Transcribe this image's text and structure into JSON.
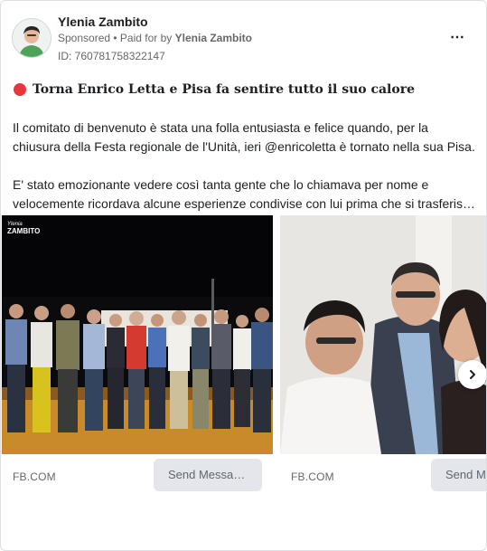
{
  "ad": {
    "advertiser_name": "Ylenia Zambito",
    "sponsored_label": "Sponsored",
    "paid_for_prefix": "• Paid for by",
    "paid_for_name": "Ylenia Zambito",
    "ad_id": "ID: 760781758322147",
    "more_icon": "⋯"
  },
  "post": {
    "headline": "Torna Enrico Letta e Pisa fa sentire tutto il suo calore",
    "paragraphs": [
      "Il comitato di benvenuto è stata una folla entusiasta e felice quando, per la chiusura della Festa regionale de l'Unità, ieri @enricoletta è tornato nella sua Pisa.",
      "E' stato emozionante vedere così tanta gente che lo chiamava per nome e velocemente ricordava alcune esperienze condivise con lui prima che si trasferis…"
    ]
  },
  "carousel": {
    "cards": [
      {
        "domain": "FB.COM",
        "cta": "Send Messa…",
        "watermark_top": "Ylenia",
        "watermark_bottom": "ZAMBITO"
      },
      {
        "domain": "FB.COM",
        "cta": "Send M"
      }
    ]
  },
  "colors": {
    "accent_red": "#e8373c",
    "cta_bg": "#e4e6eb"
  }
}
